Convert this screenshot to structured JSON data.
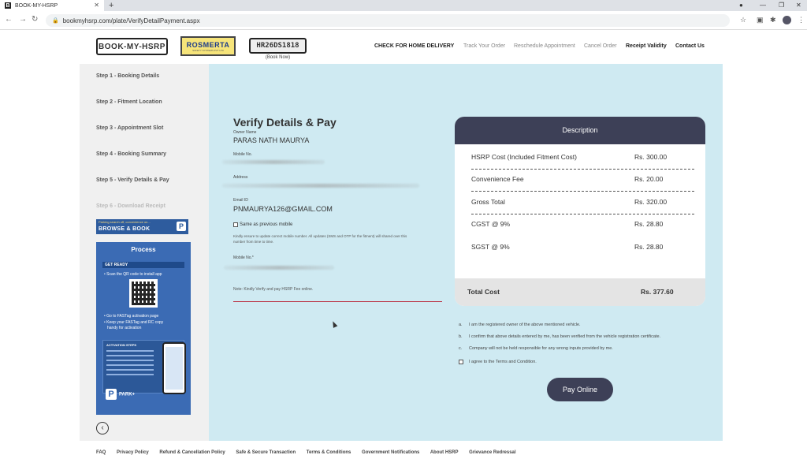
{
  "browser": {
    "tab_title": "BOOK-MY-HSRP",
    "favicon_letter": "B",
    "url": "bookmyhsrp.com/plate/VerifyDetailPayment.aspx"
  },
  "header": {
    "logo_text": "BOOK-MY-HSRP",
    "partner_logo": "ROSMERTA",
    "partner_sub": "SAFETY SYSTEMS PVT LTD",
    "plate_text": "HR26DS1818",
    "plate_caption": "(Book Now)",
    "nav": [
      "CHECK FOR HOME DELIVERY",
      "Track Your Order",
      "Reschedule Appointment",
      "Cancel Order",
      "Receipt Validity",
      "Contact Us"
    ]
  },
  "steps": [
    "Step 1 - Booking Details",
    "Step 2 - Fitment Location",
    "Step 3 - Appointment Slot",
    "Step 4 - Booking Summary",
    "Step 5 - Verify Details & Pay",
    "Step 6 - Download Receipt"
  ],
  "promo": {
    "top_line": "Parking search off, convenience on...",
    "main": "BROWSE & BOOK",
    "process_title": "Process",
    "get_ready": "GET READY",
    "scan": "Scan the QR code to install app",
    "go_fastag": "Go to FASTag activation page",
    "keep_ready": "Keep your FASTag and RC copy",
    "handy": "handy for activation",
    "activation_steps": "ACTIVATION STEPS",
    "brand": "PARK+"
  },
  "form": {
    "title": "Verify Details & Pay",
    "owner_label": "Owner Name",
    "owner_value": "PARAS NATH MAURYA",
    "mobile_label": "Mobile No.",
    "address_label": "Address",
    "email_label": "Email ID",
    "email_value": "PNMAURYA126@GMAIL.COM",
    "same_mobile": "Same as previous mobile",
    "notice_1": "Kindly ensure to update correct mobile number. All updates (SMS and OTP for the fitment) will shared over this",
    "notice_2": "number from time to time.",
    "mobile2_label": "Mobile No.*",
    "note": "Note: Kindly Verify and pay HSRP Fee online."
  },
  "description": {
    "title": "Description",
    "rows": [
      {
        "label": "HSRP Cost (Included Fitment Cost)",
        "value": "Rs. 300.00"
      },
      {
        "label": "Convenience Fee",
        "value": "Rs. 20.00"
      },
      {
        "label": "Gross Total",
        "value": "Rs. 320.00"
      },
      {
        "label": "CGST @ 9%",
        "value": "Rs. 28.80"
      },
      {
        "label": "SGST @ 9%",
        "value": "Rs. 28.80"
      }
    ],
    "total_label": "Total Cost",
    "total_value": "Rs. 377.60"
  },
  "terms": [
    {
      "mark": "a.",
      "text": "I am the registered owner of the above mentioned vehicle."
    },
    {
      "mark": "b.",
      "text": "I confirm that above details entered by me, has been verified from the vehicle registration certificate."
    },
    {
      "mark": "c.",
      "text": "Company will not be held responsible for any wrong inputs provided by me."
    }
  ],
  "agree": "I agree to the Terms and Condition.",
  "pay_button": "Pay Online",
  "footer": [
    "FAQ",
    "Privacy Policy",
    "Refund & Cancellation Policy",
    "Safe & Secure Transaction",
    "Terms & Conditions",
    "Government Notifications",
    "About HSRP",
    "Grievance Redressal"
  ],
  "colors": {
    "main_bg": "#cfeaf2",
    "card_header": "#3d4057",
    "promo_blue": "#3b6bb4"
  }
}
